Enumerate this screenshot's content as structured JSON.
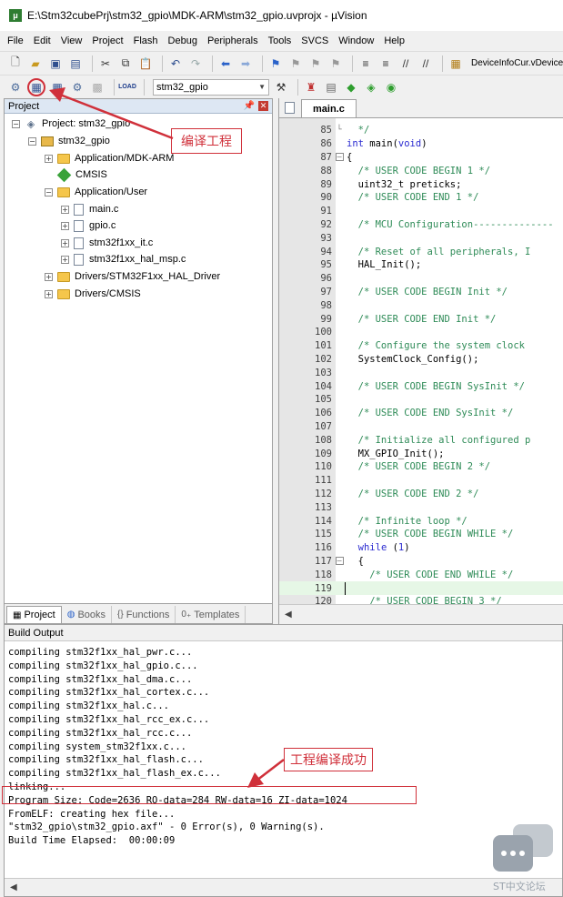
{
  "window": {
    "title": "E:\\Stm32cubePrj\\stm32_gpio\\MDK-ARM\\stm32_gpio.uvprojx - µVision"
  },
  "menu": [
    "File",
    "Edit",
    "View",
    "Project",
    "Flash",
    "Debug",
    "Peripherals",
    "Tools",
    "SVCS",
    "Window",
    "Help"
  ],
  "toolbar1": {
    "icons": [
      "new-file-icon",
      "open-folder-icon",
      "save-icon",
      "save-all-icon",
      "cut-icon",
      "copy-icon",
      "paste-icon",
      "undo-icon",
      "redo-icon",
      "nav-back-icon",
      "nav-forward-icon",
      "bookmark-icon",
      "bookmark-prev-icon",
      "bookmark-next-icon",
      "bookmark-clear-icon",
      "indent-icon",
      "unindent-icon",
      "comment-icon",
      "uncomment-icon",
      "find-in-files-icon"
    ],
    "find_text": "DeviceInfoCur.vDevice[j"
  },
  "toolbar2": {
    "target": "stm32_gpio",
    "load_label": "LOAD"
  },
  "project_panel": {
    "title": "Project",
    "tree": {
      "project": "Project: stm32_gpio",
      "target": "stm32_gpio",
      "groups": [
        {
          "label": "Application/MDK-ARM"
        },
        {
          "label": "CMSIS"
        },
        {
          "label": "Application/User"
        },
        {
          "label": "main.c"
        },
        {
          "label": "gpio.c"
        },
        {
          "label": "stm32f1xx_it.c"
        },
        {
          "label": "stm32f1xx_hal_msp.c"
        },
        {
          "label": "Drivers/STM32F1xx_HAL_Driver"
        },
        {
          "label": "Drivers/CMSIS"
        }
      ]
    },
    "tabs": [
      "Project",
      "Books",
      "Functions",
      "Templates"
    ]
  },
  "editor": {
    "tab": "main.c",
    "lines": [
      {
        "n": "85",
        "fold": "end",
        "text": "  */",
        "style": "comment"
      },
      {
        "n": "86",
        "fold": "",
        "text": "int main(void)",
        "style": "kw"
      },
      {
        "n": "87",
        "fold": "box",
        "text": "{",
        "style": ""
      },
      {
        "n": "88",
        "fold": "",
        "text": "  /* USER CODE BEGIN 1 */",
        "style": "comment"
      },
      {
        "n": "89",
        "fold": "",
        "text": "  uint32_t preticks;",
        "style": ""
      },
      {
        "n": "90",
        "fold": "",
        "text": "  /* USER CODE END 1 */",
        "style": "comment"
      },
      {
        "n": "91",
        "fold": "",
        "text": "",
        "style": ""
      },
      {
        "n": "92",
        "fold": "",
        "text": "  /* MCU Configuration--------------",
        "style": "comment"
      },
      {
        "n": "93",
        "fold": "",
        "text": "",
        "style": ""
      },
      {
        "n": "94",
        "fold": "",
        "text": "  /* Reset of all peripherals, I",
        "style": "comment"
      },
      {
        "n": "95",
        "fold": "",
        "text": "  HAL_Init();",
        "style": ""
      },
      {
        "n": "96",
        "fold": "",
        "text": "",
        "style": ""
      },
      {
        "n": "97",
        "fold": "",
        "text": "  /* USER CODE BEGIN Init */",
        "style": "comment"
      },
      {
        "n": "98",
        "fold": "",
        "text": "",
        "style": ""
      },
      {
        "n": "99",
        "fold": "",
        "text": "  /* USER CODE END Init */",
        "style": "comment"
      },
      {
        "n": "100",
        "fold": "",
        "text": "",
        "style": ""
      },
      {
        "n": "101",
        "fold": "",
        "text": "  /* Configure the system clock",
        "style": "comment"
      },
      {
        "n": "102",
        "fold": "",
        "text": "  SystemClock_Config();",
        "style": ""
      },
      {
        "n": "103",
        "fold": "",
        "text": "",
        "style": ""
      },
      {
        "n": "104",
        "fold": "",
        "text": "  /* USER CODE BEGIN SysInit */",
        "style": "comment"
      },
      {
        "n": "105",
        "fold": "",
        "text": "",
        "style": ""
      },
      {
        "n": "106",
        "fold": "",
        "text": "  /* USER CODE END SysInit */",
        "style": "comment"
      },
      {
        "n": "107",
        "fold": "",
        "text": "",
        "style": ""
      },
      {
        "n": "108",
        "fold": "",
        "text": "  /* Initialize all configured p",
        "style": "comment"
      },
      {
        "n": "109",
        "fold": "",
        "text": "  MX_GPIO_Init();",
        "style": ""
      },
      {
        "n": "110",
        "fold": "",
        "text": "  /* USER CODE BEGIN 2 */",
        "style": "comment"
      },
      {
        "n": "111",
        "fold": "",
        "text": "",
        "style": ""
      },
      {
        "n": "112",
        "fold": "",
        "text": "  /* USER CODE END 2 */",
        "style": "comment"
      },
      {
        "n": "113",
        "fold": "",
        "text": "",
        "style": ""
      },
      {
        "n": "114",
        "fold": "",
        "text": "  /* Infinite loop */",
        "style": "comment"
      },
      {
        "n": "115",
        "fold": "",
        "text": "  /* USER CODE BEGIN WHILE */",
        "style": "comment"
      },
      {
        "n": "116",
        "fold": "",
        "text": "  while (1)",
        "style": "kw"
      },
      {
        "n": "117",
        "fold": "box",
        "text": "  {",
        "style": ""
      },
      {
        "n": "118",
        "fold": "",
        "text": "    /* USER CODE END WHILE */",
        "style": "comment"
      },
      {
        "n": "119",
        "fold": "",
        "text": "",
        "style": "current"
      },
      {
        "n": "120",
        "fold": "",
        "text": "    /* USER CODE BEGIN 3 */",
        "style": "comment"
      }
    ]
  },
  "build_output": {
    "title": "Build Output",
    "lines": [
      "compiling stm32f1xx_hal_pwr.c...",
      "compiling stm32f1xx_hal_gpio.c...",
      "compiling stm32f1xx_hal_dma.c...",
      "compiling stm32f1xx_hal_cortex.c...",
      "compiling stm32f1xx_hal.c...",
      "compiling stm32f1xx_hal_rcc_ex.c...",
      "compiling stm32f1xx_hal_rcc.c...",
      "compiling system_stm32f1xx.c...",
      "compiling stm32f1xx_hal_flash.c...",
      "compiling stm32f1xx_hal_flash_ex.c...",
      "linking...",
      "Program Size: Code=2636 RO-data=284 RW-data=16 ZI-data=1024",
      "FromELF: creating hex file...",
      "\"stm32_gpio\\stm32_gpio.axf\" - 0 Error(s), 0 Warning(s).",
      "Build Time Elapsed:  00:00:09"
    ]
  },
  "annotations": {
    "compile_project": "编译工程",
    "compile_success": "工程编译成功",
    "color": "#d0303a"
  },
  "watermark": {
    "text": "ST中文论坛"
  }
}
